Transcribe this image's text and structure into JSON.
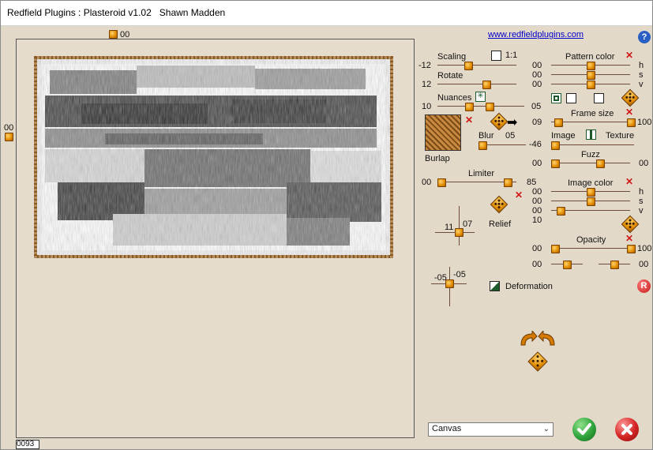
{
  "window": {
    "title": "Redfield Plugins : Plasteroid v1.02   Shawn Madden"
  },
  "link": "www.redfieldplugins.com",
  "preview": {
    "top_value": "00",
    "left_value": "00",
    "corner_value": "0093"
  },
  "scaling": {
    "label": "Scaling",
    "value": "-12",
    "ratio_label": "1:1"
  },
  "rotate": {
    "label": "Rotate",
    "value": "12"
  },
  "nuances": {
    "label": "Nuances",
    "value_left": "10",
    "value_right": "05"
  },
  "texture_name": "Burlap",
  "blur": {
    "label": "Blur",
    "value": "05"
  },
  "limiter": {
    "label": "Limiter",
    "min": "00",
    "max": "85"
  },
  "relief": {
    "label": "Relief",
    "x_value": "11",
    "y_value": "07"
  },
  "deformation": {
    "label": "Deformation",
    "x_value": "-05",
    "y_value": "-05"
  },
  "pattern_color": {
    "label": "Pattern color",
    "rows": [
      {
        "value": "00",
        "channel": "h"
      },
      {
        "value": "00",
        "channel": "s"
      },
      {
        "value": "00",
        "channel": "v"
      }
    ]
  },
  "frame_size": {
    "label": "Frame size",
    "min": "09",
    "max": "100"
  },
  "image_texture": {
    "image_label": "Image",
    "texture_label": "Texture",
    "value": "-46"
  },
  "fuzz": {
    "label": "Fuzz",
    "min": "00",
    "max": "00"
  },
  "image_color": {
    "label": "Image color",
    "rows": [
      {
        "value": "00",
        "channel": "h"
      },
      {
        "value": "00",
        "channel": "s"
      },
      {
        "value": "00",
        "channel": "v"
      }
    ],
    "extra_value": "10"
  },
  "opacity": {
    "label": "Opacity",
    "min": "00",
    "max": "100",
    "row2_left": "00",
    "row2_right": "00"
  },
  "canvas_select": {
    "value": "Canvas"
  },
  "buttons": {
    "help": "?",
    "reset": "R"
  },
  "colors": {
    "accent": "#e08a00",
    "ok": "#2fa33b",
    "cancel": "#d32222"
  }
}
